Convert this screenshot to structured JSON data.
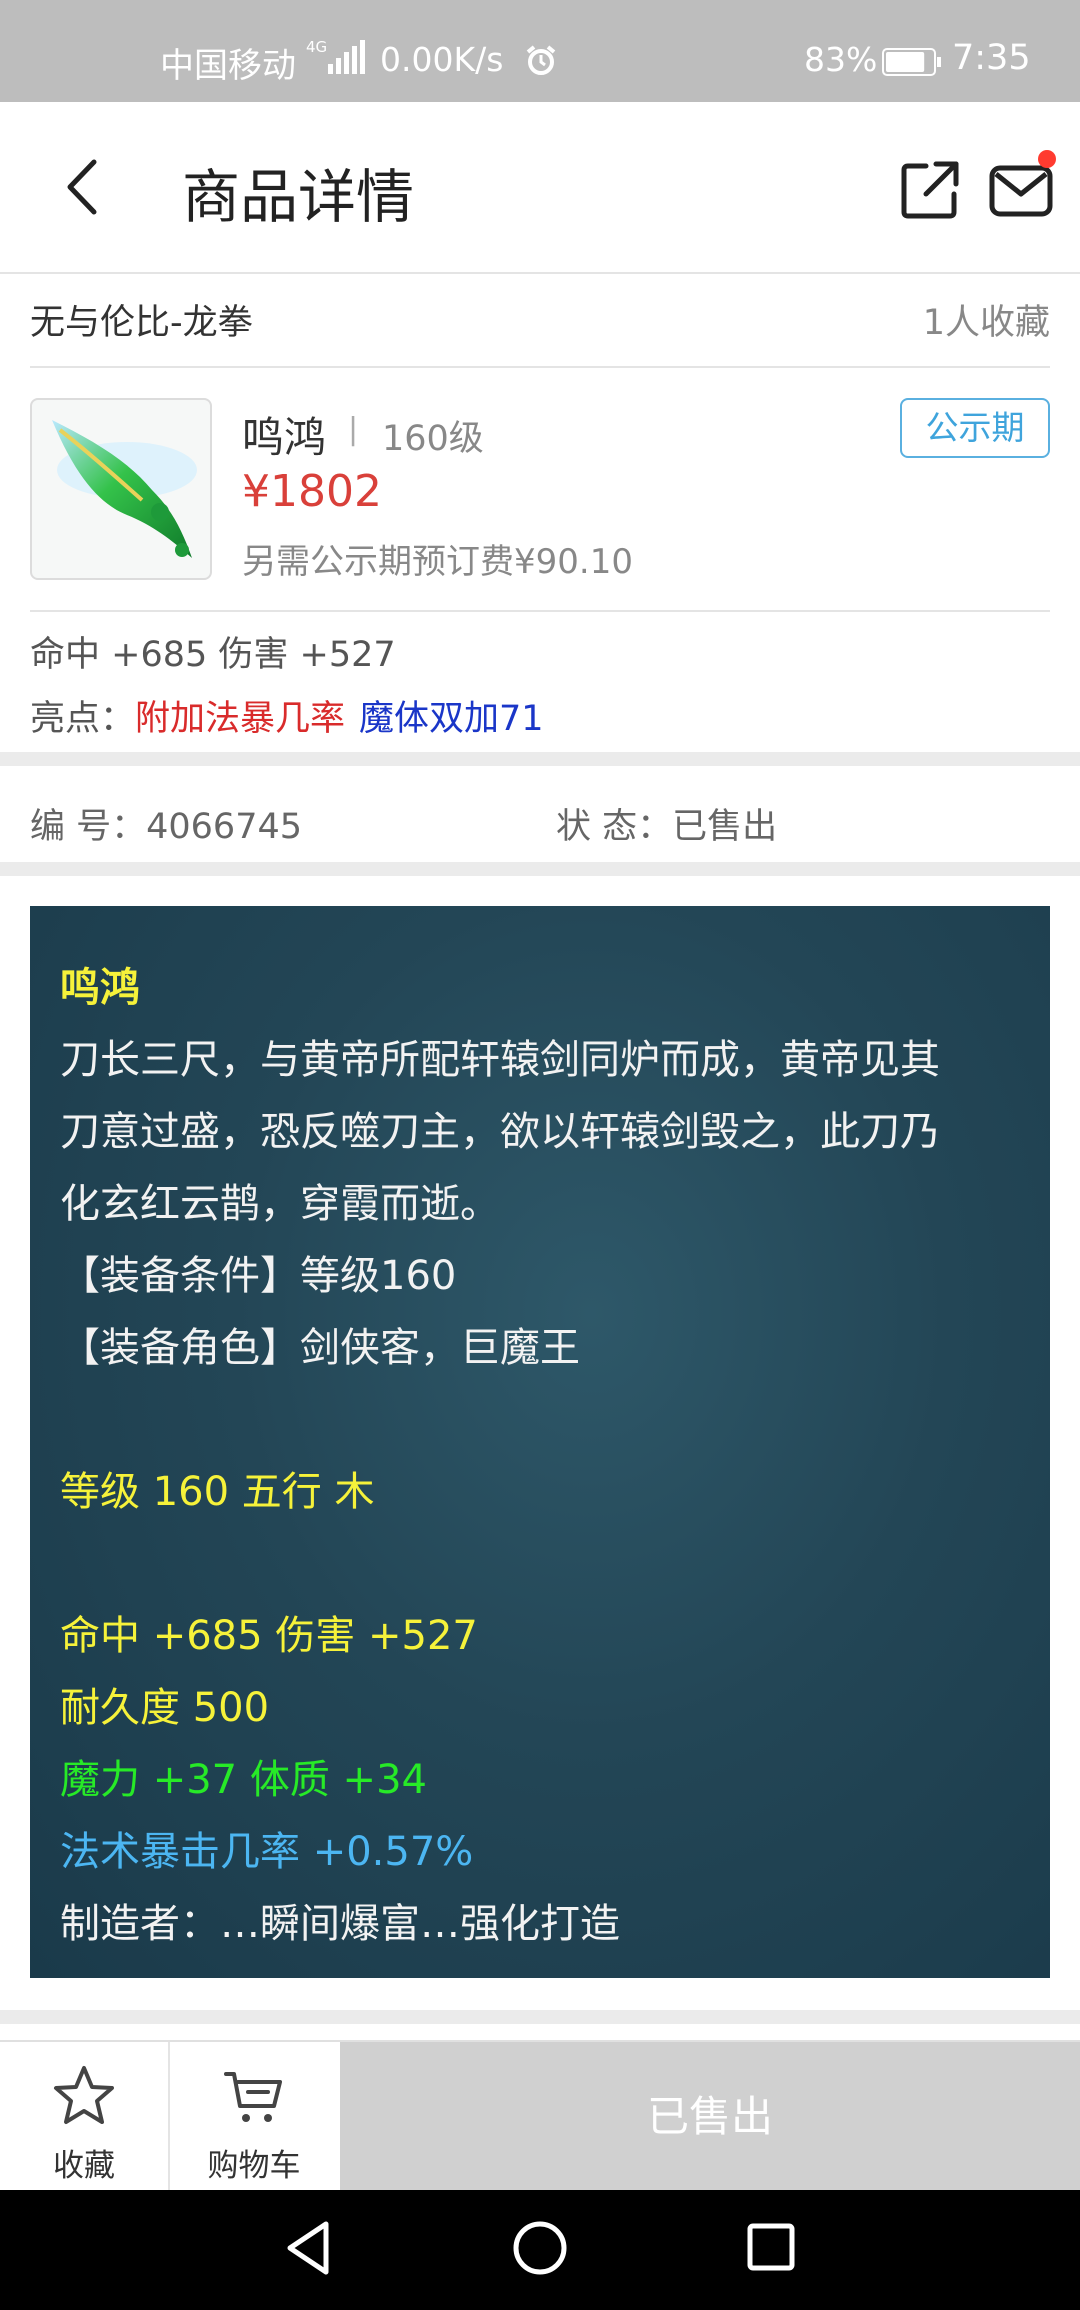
{
  "status_bar": {
    "carrier": "中国移动",
    "network_type": "4G",
    "speed": "0.00K/s",
    "battery": "83%",
    "battery_level": 0.83,
    "time": "7:35",
    "icons": [
      "signal-icon",
      "alarm-icon",
      "battery-icon"
    ]
  },
  "header": {
    "title": "商品详情",
    "icons": [
      "back-icon",
      "share-icon",
      "mail-icon"
    ],
    "notification_dot_color": "#ff3b30"
  },
  "seller": {
    "name": "无与伦比-龙拳",
    "favorites": "1人收藏"
  },
  "item": {
    "name": "鸣鸿",
    "separator": "|",
    "level": "160级",
    "price": "¥1802",
    "fee_note": "另需公示期预订费¥90.10",
    "badge": "公示期",
    "attributes": "命中 +685 伤害 +527",
    "highlights_label": "亮点：",
    "highlights": [
      {
        "text": "附加法暴几率",
        "color": "#d92b2b"
      },
      {
        "text": "魔体双加71",
        "color": "#1a36c8"
      }
    ]
  },
  "info": {
    "number": "编  号：4066745",
    "status": "状  态：已售出"
  },
  "description": {
    "title": "鸣鸿",
    "lore": [
      "刀长三尺，与黄帝所配轩辕剑同炉而成，黄帝见其",
      "刀意过盛，恐反噬刀主，欲以轩辕剑毁之，此刀乃",
      "化玄红云鹊，穿霞而逝。"
    ],
    "requirement": "【装备条件】等级160",
    "roles": "【装备角色】剑侠客，巨魔王",
    "level_element": "等级 160 五行 木",
    "stats": "命中 +685 伤害 +527",
    "durability": "耐久度 500",
    "bonus": "魔力 +37 体质 +34",
    "special": "法术暴击几率 +0.57%",
    "maker": "制造者：…瞬间爆富…强化打造",
    "colors": {
      "yellow": "#f6f23a",
      "white": "#f2f2f2",
      "green": "#27ea27",
      "blue": "#4cb6f2",
      "background": "#1f4252"
    }
  },
  "bottom_bar": {
    "favorite_label": "收藏",
    "cart_label": "购物车",
    "sold_label": "已售出",
    "icons": [
      "star-icon",
      "cart-icon"
    ]
  },
  "system_nav": {
    "icons": [
      "nav-back-icon",
      "nav-home-icon",
      "nav-recent-icon"
    ]
  },
  "colors": {
    "price": "#d9403a",
    "badge": "#3fa4dc",
    "status_bar_bg": "#bdbdbd",
    "sold_button_bg": "#d0d0d0"
  }
}
